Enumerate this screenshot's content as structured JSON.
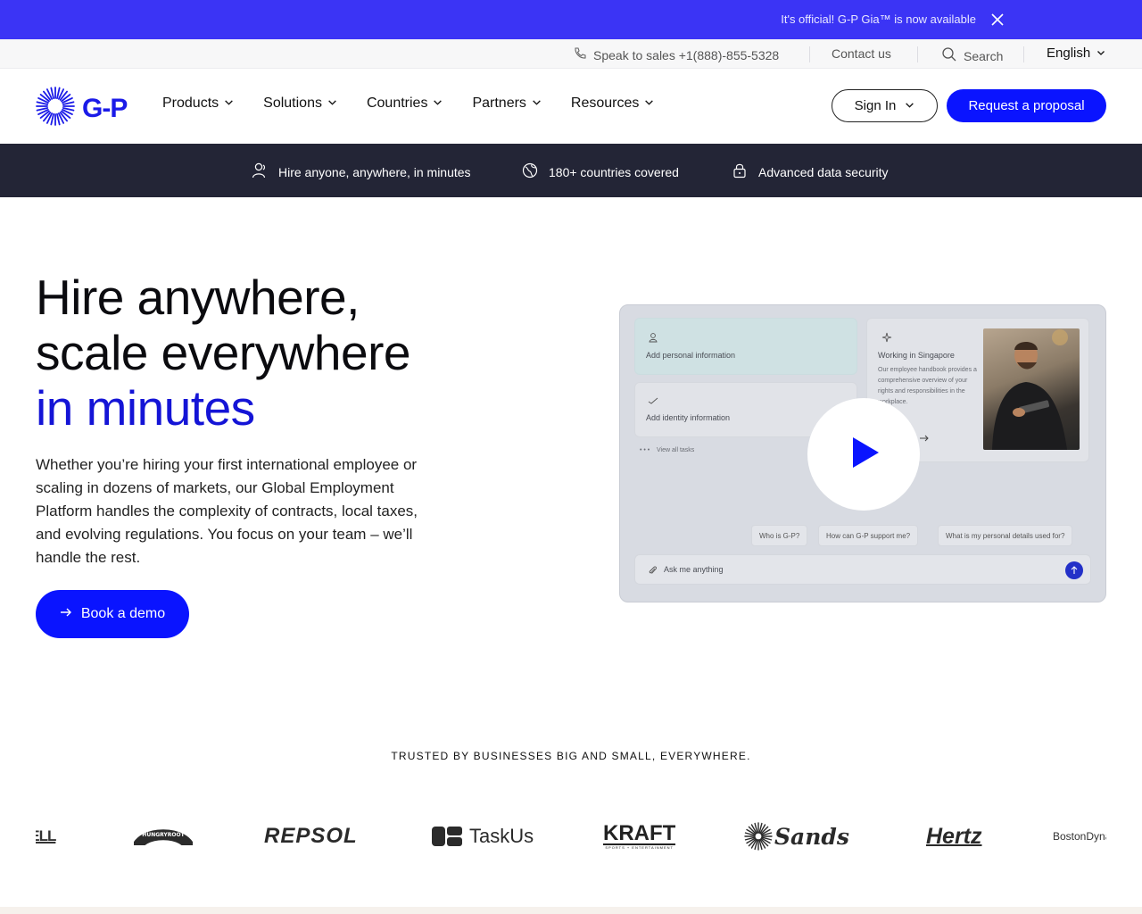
{
  "announcement": {
    "text": "It's official! G-P Gia™ is now available",
    "close_icon": "close-icon"
  },
  "utility_bar": {
    "phone_icon": "phone-icon",
    "sales": "Speak to sales +1(888)-855-5328",
    "contact": "Contact us",
    "search_icon": "search-icon",
    "search": "Search",
    "language": "English"
  },
  "nav": {
    "logo_text": "G-P",
    "menu": [
      {
        "label": "Products"
      },
      {
        "label": "Solutions"
      },
      {
        "label": "Countries"
      },
      {
        "label": "Partners"
      },
      {
        "label": "Resources"
      }
    ],
    "signin": "Sign In",
    "proposal": "Request a proposal"
  },
  "features": [
    {
      "icon": "person-icon",
      "label": "Hire anyone, anywhere, in minutes"
    },
    {
      "icon": "globe-icon",
      "label": "180+ countries covered"
    },
    {
      "icon": "lock-icon",
      "label": "Advanced data security"
    }
  ],
  "hero": {
    "line1": "Hire anywhere,",
    "line2": "scale everywhere",
    "line3": "in minutes",
    "paragraph": "Whether you’re hiring your first international employee or scaling in dozens of markets, our Global Employment Platform handles the complexity of contracts, local taxes, and evolving regulations. You focus on your team – we’ll handle the rest.",
    "cta": "Book a demo"
  },
  "video": {
    "task1": "Add personal information",
    "task2": "Add identity information",
    "view_all": "View all tasks",
    "card_title": "Working in Singapore",
    "card_body": "Our employee handbook provides a comprehensive overview of your rights and responsibilities in the workplace.",
    "chips": [
      "Who is G-P?",
      "How can G-P support me?",
      "What is my personal details used for?"
    ],
    "ask_placeholder": "Ask me anything",
    "play_icon": "play-icon"
  },
  "trusted": {
    "heading": "TRUSTED BY BUSINESSES BIG AND SMALL, EVERYWHERE."
  },
  "logos": [
    "DELL",
    "HUNGRYROOT",
    "REPSOL",
    "TaskUs",
    "KRAFT",
    "SPORTS + ENTERTAINMENT",
    "Sands",
    "Hertz",
    "BostonDynamics"
  ],
  "colors": {
    "brand_blue": "#0a14ff",
    "announce_bg": "#3b34f5",
    "feature_bar_bg": "#232536"
  }
}
